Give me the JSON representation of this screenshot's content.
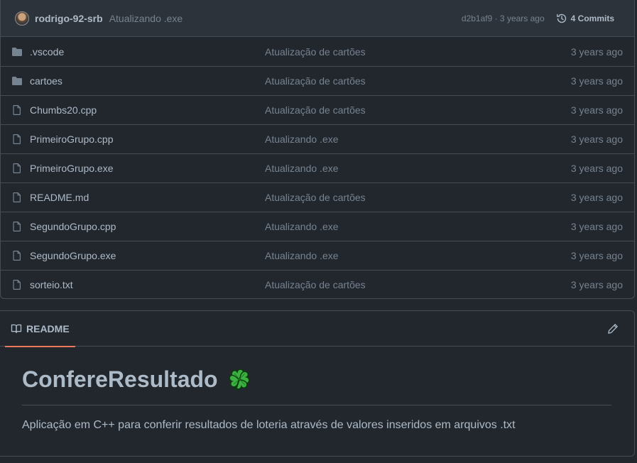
{
  "commit": {
    "author": "rodrigo-92-srb",
    "message": "Atualizando .exe",
    "hash_time": "d2b1af9 · 3 years ago",
    "history_label": "4 Commits"
  },
  "files": [
    {
      "name": ".vscode",
      "type": "folder",
      "message": "Atualização de cartões",
      "age": "3 years ago"
    },
    {
      "name": "cartoes",
      "type": "folder",
      "message": "Atualização de cartões",
      "age": "3 years ago"
    },
    {
      "name": "Chumbs20.cpp",
      "type": "file",
      "message": "Atualização de cartões",
      "age": "3 years ago"
    },
    {
      "name": "PrimeiroGrupo.cpp",
      "type": "file",
      "message": "Atualizando .exe",
      "age": "3 years ago"
    },
    {
      "name": "PrimeiroGrupo.exe",
      "type": "file",
      "message": "Atualizando .exe",
      "age": "3 years ago"
    },
    {
      "name": "README.md",
      "type": "file",
      "message": "Atualização de cartões",
      "age": "3 years ago"
    },
    {
      "name": "SegundoGrupo.cpp",
      "type": "file",
      "message": "Atualizando .exe",
      "age": "3 years ago"
    },
    {
      "name": "SegundoGrupo.exe",
      "type": "file",
      "message": "Atualizando .exe",
      "age": "3 years ago"
    },
    {
      "name": "sorteio.txt",
      "type": "file",
      "message": "Atualização de cartões",
      "age": "3 years ago"
    }
  ],
  "readme": {
    "tab_label": "README",
    "title": "ConfereResultado",
    "title_icon": "four-leaf-clover-icon",
    "description": "Aplicação em C++ para conferir resultados de loteria através de valores inseridos em arquivos .txt"
  },
  "colors": {
    "background": "#22272e",
    "header_bg": "#2d333b",
    "border": "#444c56",
    "muted_text": "#768390",
    "text": "#adbac7",
    "tab_underline": "#ec775c",
    "folder_icon": "#768390"
  }
}
